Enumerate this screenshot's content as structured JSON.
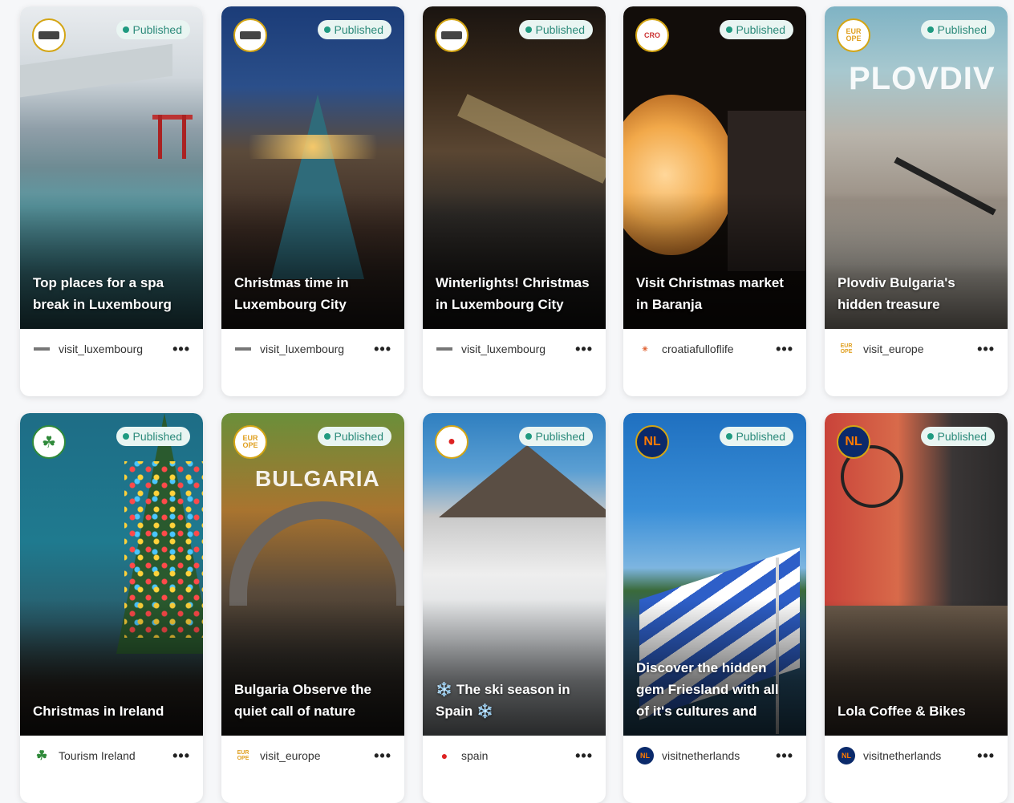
{
  "status_label": "Published",
  "cards": [
    {
      "caption": "Top places for a spa break in Luxembourg",
      "account": "visit_luxembourg"
    },
    {
      "caption": "Christmas time in Luxembourg City",
      "account": "visit_luxembourg"
    },
    {
      "caption": "Winterlights! Christmas in Luxembourg City",
      "account": "visit_luxembourg"
    },
    {
      "caption": "Visit Christmas market in Baranja",
      "account": "croatiafulloflife"
    },
    {
      "caption": "Plovdiv Bulgaria's hidden treasure",
      "account": "visit_europe",
      "overlay": "PLOVDIV"
    },
    {
      "caption": "Christmas in Ireland",
      "account": "Tourism Ireland"
    },
    {
      "caption": "Bulgaria Observe the quiet call of nature",
      "account": "visit_europe",
      "overlay": "BULGARIA"
    },
    {
      "caption": "❄️ The ski season in Spain ❄️",
      "account": "spain"
    },
    {
      "caption": "Discover the hidden gem Friesland with all of it's cultures and",
      "account": "visitnetherlands"
    },
    {
      "caption": "Lola Coffee & Bikes",
      "account": "visitnetherlands"
    }
  ],
  "logos": {
    "europe": "EUR OPE",
    "nl": "NL"
  },
  "more_label": "•••"
}
